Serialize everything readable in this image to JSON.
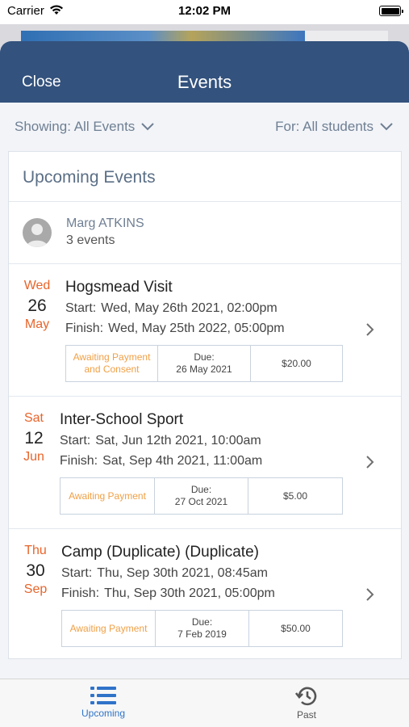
{
  "status_bar": {
    "carrier": "Carrier",
    "time": "12:02 PM"
  },
  "nav": {
    "close_label": "Close",
    "title": "Events"
  },
  "filters": {
    "showing": "Showing: All Events",
    "for": "For: All students"
  },
  "card": {
    "title": "Upcoming Events"
  },
  "student": {
    "name": "Marg ATKINS",
    "count": "3 events"
  },
  "labels": {
    "start": "Start:",
    "finish": "Finish:",
    "due": "Due:"
  },
  "events": [
    {
      "day": "Wed",
      "date": "26",
      "month": "May",
      "title": "Hogsmead Visit",
      "start": "Wed, May 26th 2021, 02:00pm",
      "finish": "Wed, May 25th 2022, 05:00pm",
      "status": "Awaiting Payment and Consent",
      "due": "26 May 2021",
      "amount": "$20.00"
    },
    {
      "day": "Sat",
      "date": "12",
      "month": "Jun",
      "title": "Inter-School Sport",
      "start": "Sat, Jun 12th 2021, 10:00am",
      "finish": "Sat, Sep 4th 2021, 11:00am",
      "status": "Awaiting Payment",
      "due": "27 Oct 2021",
      "amount": "$5.00"
    },
    {
      "day": "Thu",
      "date": "30",
      "month": "Sep",
      "title": "Camp (Duplicate) (Duplicate)",
      "start": "Thu, Sep 30th 2021, 08:45am",
      "finish": "Thu, Sep 30th 2021, 05:00pm",
      "status": "Awaiting Payment",
      "due": "7 Feb 2019",
      "amount": "$50.00"
    }
  ],
  "tabs": {
    "upcoming": "Upcoming",
    "past": "Past"
  },
  "colors": {
    "nav_bg": "#33527d",
    "accent_orange": "#e8642a",
    "status_orange": "#f0a046",
    "tab_active": "#2f73c9"
  },
  "icons": {
    "upcoming_tab": "list-icon",
    "past_tab": "history-icon",
    "row": "chevron-right-icon",
    "filter": "chevron-down-icon"
  }
}
